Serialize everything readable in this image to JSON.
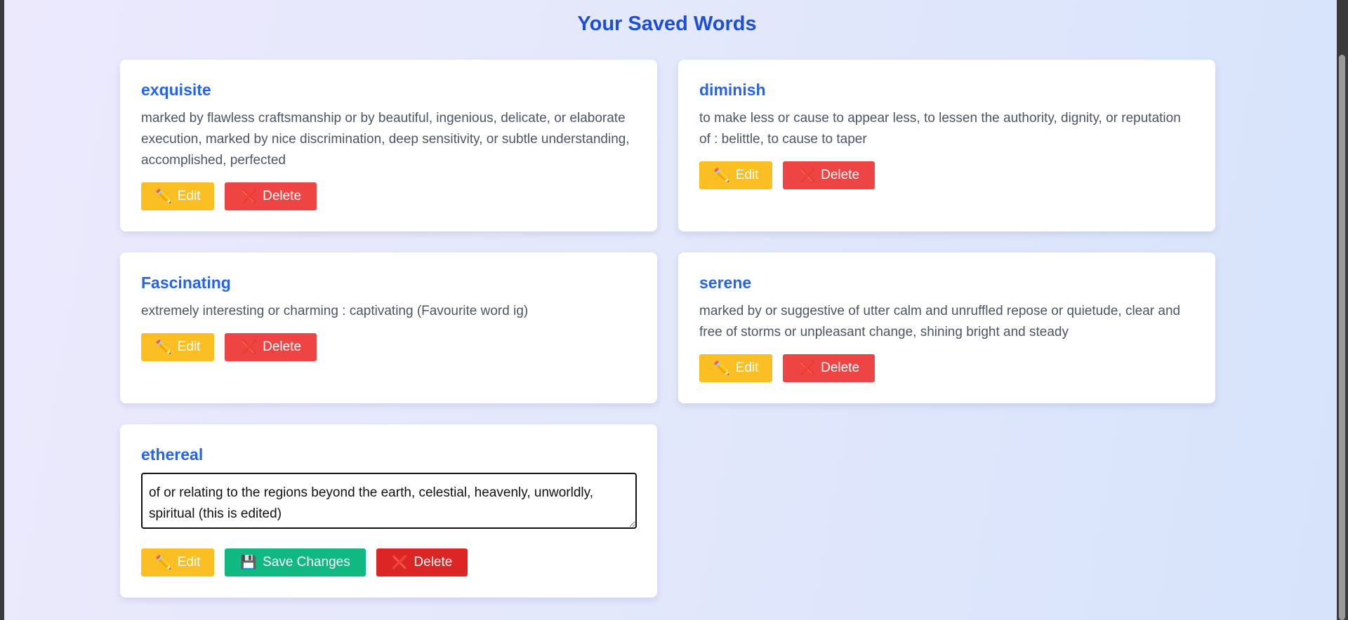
{
  "page": {
    "title": "Your Saved Words"
  },
  "words": [
    {
      "word": "exquisite",
      "definition": "marked by flawless craftsmanship or by beautiful, ingenious, delicate, or elaborate execution, marked by nice discrimination, deep sensitivity, or subtle understanding, accomplished, perfected",
      "edit_label": "Edit",
      "delete_label": "Delete"
    },
    {
      "word": "diminish",
      "definition": "to make less or cause to appear less, to lessen the authority, dignity, or reputation of : belittle, to cause to taper",
      "edit_label": "Edit",
      "delete_label": "Delete"
    },
    {
      "word": "Fascinating",
      "definition": "extremely interesting or charming : captivating (Favourite word ig)",
      "edit_label": "Edit",
      "delete_label": "Delete"
    },
    {
      "word": "serene",
      "definition": "marked by or suggestive of utter calm and unruffled repose or quietude, clear and free of storms or unpleasant change, shining bright and steady",
      "edit_label": "Edit",
      "delete_label": "Delete"
    },
    {
      "word": "ethereal",
      "definition_edit_value": "of or relating to the regions beyond the earth, celestial, heavenly, unworldly, spiritual (this is edited)",
      "edit_label": "Edit",
      "save_label": "Save Changes",
      "delete_label": "Delete"
    }
  ],
  "icons": {
    "edit": "pencil-icon",
    "delete": "cross-mark-icon",
    "save": "floppy-disk-icon"
  },
  "colors": {
    "title": "#1d4ed8",
    "word": "#2563eb",
    "edit": "#fbbf24",
    "delete": "#ef4444",
    "save": "#10b981"
  }
}
